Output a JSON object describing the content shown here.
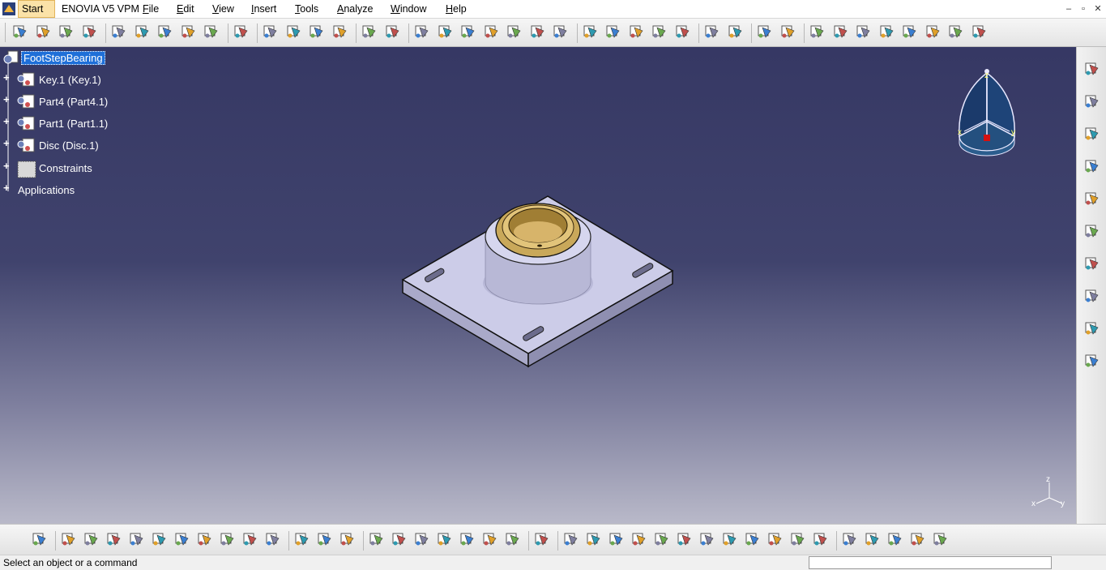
{
  "menubar": {
    "items": [
      "Start",
      "ENOVIA V5 VPM",
      "File",
      "Edit",
      "View",
      "Insert",
      "Tools",
      "Analyze",
      "Window",
      "Help"
    ]
  },
  "window_controls": [
    "–",
    "▫",
    "✕"
  ],
  "tree": {
    "root": "FootStepBearing",
    "children": [
      "Key.1 (Key.1)",
      "Part4 (Part4.1)",
      "Part1 (Part1.1)",
      "Disc (Disc.1)",
      "Constraints",
      "Applications"
    ]
  },
  "compass": {
    "z": "z",
    "x": "x",
    "y": "y"
  },
  "axis_triad": {
    "z": "z",
    "x": "x",
    "y": "y"
  },
  "status": {
    "text": "Select an object or a command"
  },
  "colors": {
    "viewport_top": "#363864",
    "viewport_bottom": "#b9b9c9",
    "plate": "#c9c9e6",
    "bushing": "#c9a85a",
    "selection": "#1e6fd8"
  },
  "icons": {
    "top_toolbar": [
      "product-icon",
      "component-icon",
      "existing-component-icon",
      "existing-component-position-icon",
      "snap-icon",
      "smart-move-icon",
      "explode-icon",
      "stop-manipulation-icon",
      "reorder-icon",
      "bill-of-material-icon",
      "point-icon",
      "spline-icon",
      "circle-icon",
      "plane-icon",
      "join-icon",
      "extract-icon",
      "pad-icon",
      "pocket-icon",
      "hole-icon",
      "shaft-icon",
      "groove-icon",
      "fillet-icon",
      "chamfer-icon",
      "draft-icon",
      "shell-icon",
      "thickness-icon",
      "split-icon",
      "measure-icon",
      "clash-icon",
      "distance-icon",
      "section-icon",
      "sketch-icon",
      "boolean-icon",
      "catalog-icon",
      "publication-icon",
      "scene-icon",
      "annotation-icon",
      "view-icon",
      "update-icon",
      "parameters-icon"
    ],
    "right_toolbar": [
      "gear-icon",
      "select-arrow-icon",
      "manipulation-icon",
      "new-component-icon",
      "replace-icon",
      "reorder-product-icon",
      "constraint-coincidence-icon",
      "constraint-contact-icon",
      "constraint-offset-icon",
      "grid-icon"
    ],
    "bottom_toolbar": [
      "sketcher-icon",
      "new-file-icon",
      "open-file-icon",
      "save-icon",
      "print-icon",
      "cut-icon",
      "copy-icon",
      "paste-icon",
      "undo-icon",
      "redo-icon",
      "help-icon",
      "measure-between-icon",
      "measure-item-icon",
      "weight-icon",
      "formula-icon",
      "comment-icon",
      "design-table-icon",
      "table-icon",
      "knowledge-icon",
      "lock-icon",
      "rules-icon",
      "capture-icon",
      "fly-mode-icon",
      "fit-all-icon",
      "pan-icon",
      "rotate-icon",
      "zoom-in-icon",
      "zoom-out-icon",
      "normal-view-icon",
      "multi-view-icon",
      "isometric-view-icon",
      "shading-icon",
      "hide-show-icon",
      "swap-visible-icon",
      "sketch-tool-icon",
      "update-all-icon",
      "options-icon",
      "catalog-browser-icon",
      "catia-logo"
    ]
  }
}
